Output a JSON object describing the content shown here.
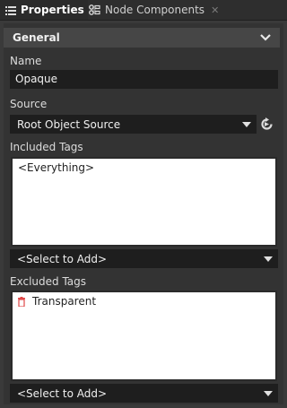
{
  "tabs": [
    {
      "label": "Properties",
      "icon": "list-icon",
      "active": true
    },
    {
      "label": "Node Components",
      "icon": "components-icon",
      "active": false
    }
  ],
  "section": {
    "title": "General",
    "icon": "chevron-down-icon"
  },
  "name": {
    "label": "Name",
    "value": "Opaque"
  },
  "source": {
    "label": "Source",
    "value": "Root Object Source",
    "action_icon": "go-to-source-icon"
  },
  "included_tags": {
    "label": "Included Tags",
    "items": [
      "<Everything>"
    ],
    "add_placeholder": "<Select to Add>"
  },
  "excluded_tags": {
    "label": "Excluded Tags",
    "items": [
      "Transparent"
    ],
    "item_icon": "trash-icon",
    "add_placeholder": "<Select to Add>"
  },
  "colors": {
    "accent_icon": "#e04848"
  }
}
